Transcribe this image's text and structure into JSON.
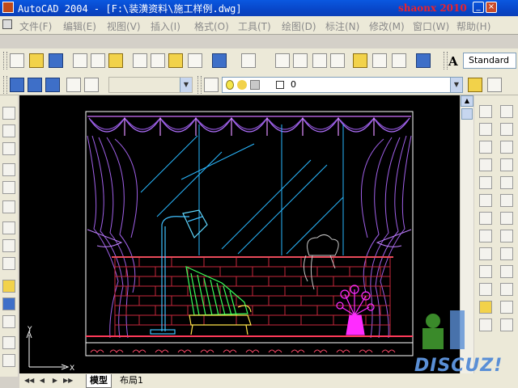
{
  "window": {
    "title": "AutoCAD 2004 - [F:\\装潢资料\\施工样例.dwg]",
    "watermark": "shaonx 2010",
    "minimize_glyph": "_",
    "close_glyph": "×"
  },
  "menu": {
    "items": [
      "文件(F)",
      "编辑(E)",
      "视图(V)",
      "插入(I)",
      "格式(O)",
      "工具(T)",
      "绘图(D)",
      "标注(N)",
      "修改(M)",
      "窗口(W)",
      "帮助(H)"
    ]
  },
  "toolbar": {
    "text_style": "Standard",
    "text_style_icon": "A",
    "layer_value": "0"
  },
  "canvas": {
    "background": "#000000",
    "ucs_y": "Y",
    "ucs_x": "X"
  },
  "tabs": {
    "nav": [
      "◀◀",
      "◀",
      "▶",
      "▶▶"
    ],
    "items": [
      "模型",
      "布局1"
    ],
    "active": "模型"
  },
  "brand": {
    "discuz": "DISCUZ!"
  }
}
